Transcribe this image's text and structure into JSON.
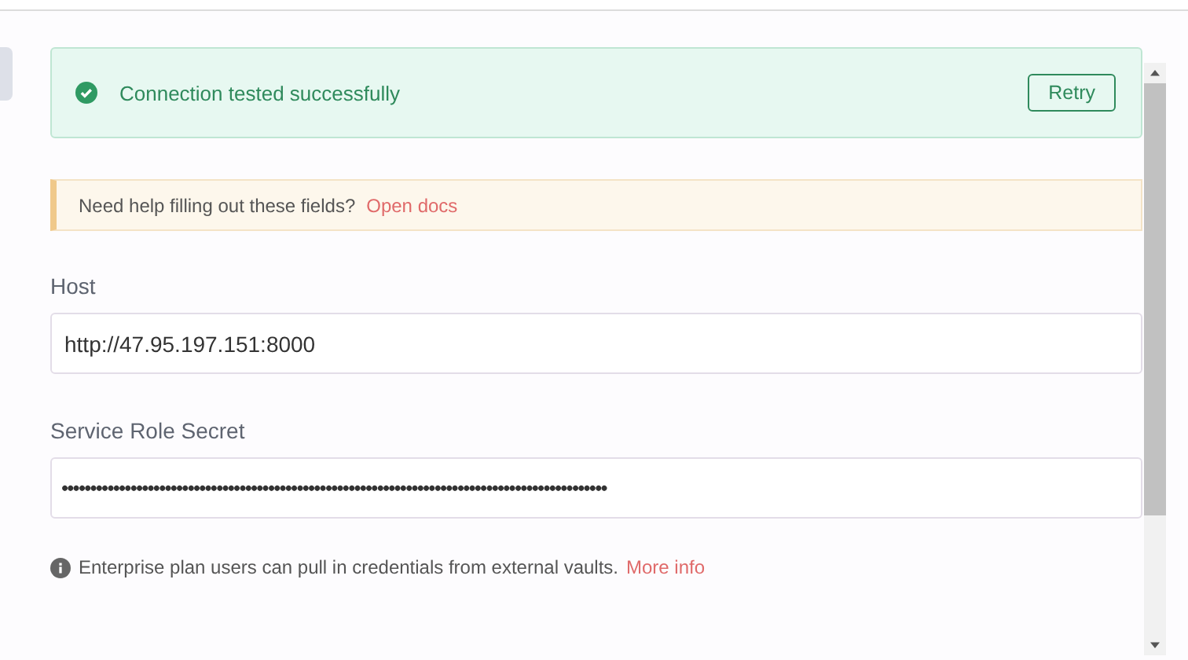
{
  "success_alert": {
    "message": "Connection tested successfully",
    "button": "Retry"
  },
  "help_banner": {
    "text": "Need help filling out these fields?",
    "link": "Open docs"
  },
  "fields": [
    {
      "label": "Host",
      "value": "http://47.95.197.151:8000",
      "kind": "text"
    },
    {
      "label": "Service Role Secret",
      "value": "•••••••••••••••••••••••••••••••••••••••••••••••••••••••••••••••••••••••••••••••••••••••••••••••",
      "kind": "secret"
    }
  ],
  "info_note": {
    "text": "Enterprise plan users can pull in credentials from external vaults.",
    "link": "More info"
  }
}
